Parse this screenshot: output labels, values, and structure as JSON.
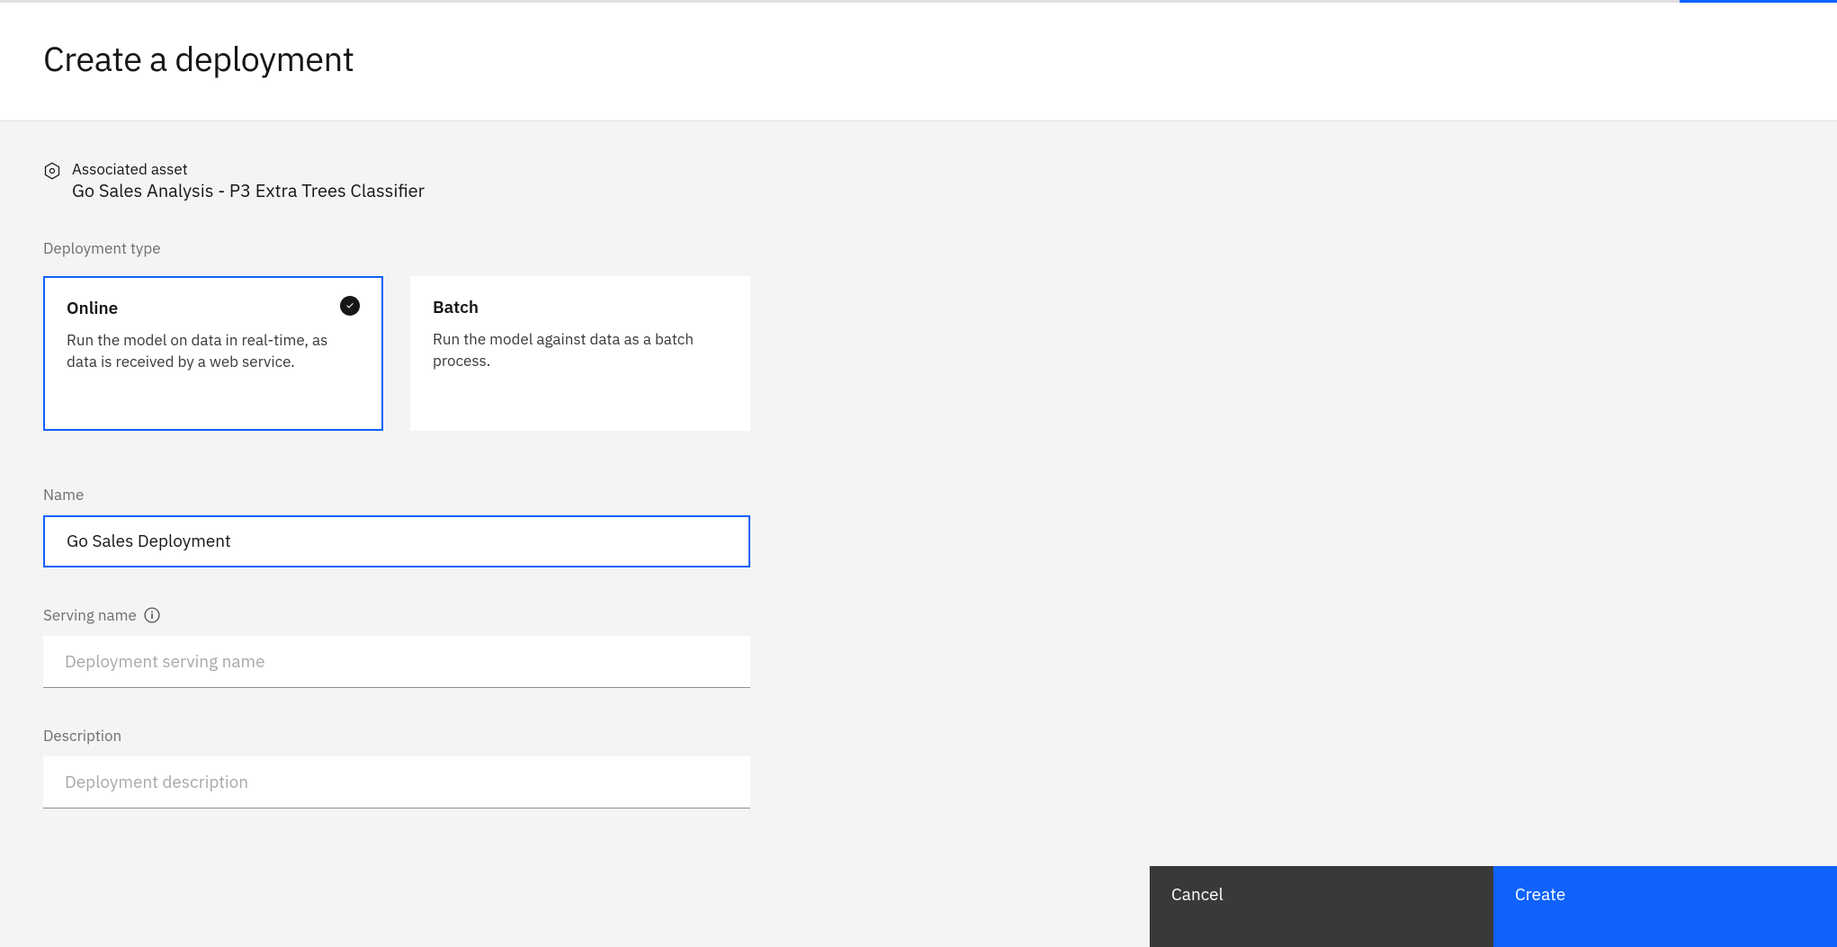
{
  "header": {
    "title": "Create a deployment"
  },
  "asset": {
    "label": "Associated asset",
    "value": "Go Sales Analysis - P3 Extra Trees Classifier"
  },
  "deploymentType": {
    "label": "Deployment type",
    "options": [
      {
        "title": "Online",
        "desc": "Run the model on data in real-time, as data is received by a web service.",
        "selected": true
      },
      {
        "title": "Batch",
        "desc": "Run the model against data as a batch process.",
        "selected": false
      }
    ]
  },
  "fields": {
    "name": {
      "label": "Name",
      "value": "Go Sales Deployment"
    },
    "servingName": {
      "label": "Serving name",
      "placeholder": "Deployment serving name",
      "value": ""
    },
    "description": {
      "label": "Description",
      "placeholder": "Deployment description",
      "value": ""
    }
  },
  "footer": {
    "cancel": "Cancel",
    "create": "Create"
  }
}
